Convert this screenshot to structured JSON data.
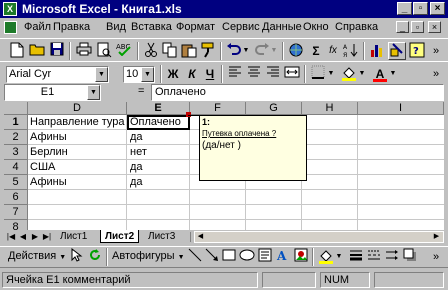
{
  "window": {
    "title": "Microsoft Excel - Книга1.xls",
    "app_icon": "excel-icon",
    "controls": [
      "_",
      "▫",
      "×"
    ]
  },
  "menu": {
    "items": [
      "Файл",
      "Правка",
      "Вид",
      "Вставка",
      "Формат",
      "Сервис",
      "Данные",
      "Окно",
      "Справка"
    ],
    "doc_controls": [
      "_",
      "▫",
      "×"
    ]
  },
  "formatting": {
    "font": "Arial Cyr",
    "size": "10",
    "bold": "Ж",
    "italic": "К",
    "underline": "Ч",
    "font_color_label": "A"
  },
  "standard_toolbar": {
    "autosum": "Σ",
    "function": "fx",
    "zoom_icon": "zoom-icon"
  },
  "formula_bar": {
    "name_box": "E1",
    "equals": "=",
    "content": "Оплачено"
  },
  "grid": {
    "columns": [
      "D",
      "E",
      "F",
      "G",
      "H",
      "I"
    ],
    "rows": [
      "1",
      "2",
      "3",
      "4",
      "5",
      "6",
      "7",
      "8"
    ],
    "cells": [
      [
        "Направление тура",
        "Оплачено"
      ],
      [
        "Афины",
        "да"
      ],
      [
        "Берлин",
        "нет"
      ],
      [
        "США",
        "да"
      ],
      [
        "Афины",
        "да"
      ],
      [
        "",
        ""
      ],
      [
        "",
        ""
      ],
      [
        "",
        ""
      ]
    ],
    "selected": "E1"
  },
  "comment": {
    "author": "1:",
    "title": "Путевка оплачена ?",
    "text": "(да/нет )"
  },
  "sheets": {
    "tabs": [
      "Лист1",
      "Лист2",
      "Лист3"
    ],
    "active": "Лист2"
  },
  "drawing_toolbar": {
    "actions": "Действия",
    "autoshapes": "Автофигуры"
  },
  "status": {
    "text": "Ячейка E1 комментарий",
    "num": "NUM"
  }
}
